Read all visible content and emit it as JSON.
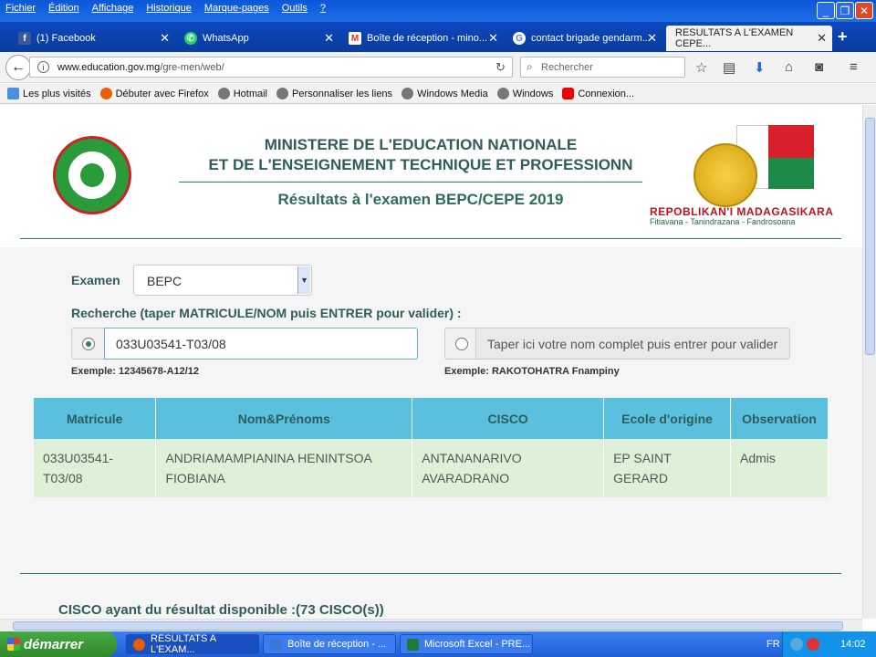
{
  "menubar": {
    "items": [
      "Fichier",
      "Édition",
      "Affichage",
      "Historique",
      "Marque-pages",
      "Outils",
      "?"
    ]
  },
  "tabs": [
    {
      "label": "(1) Facebook",
      "icon": "facebook-icon",
      "color": "#3b5998"
    },
    {
      "label": "WhatsApp",
      "icon": "whatsapp-icon",
      "color": "#25d366"
    },
    {
      "label": "Boîte de réception - mino...",
      "icon": "gmail-icon",
      "color": "#d93025"
    },
    {
      "label": "contact brigade gendarm...",
      "icon": "google-icon",
      "color": "#4285f4"
    },
    {
      "label": "RESULTATS A L'EXAMEN CEPE...",
      "icon": "",
      "color": ""
    }
  ],
  "navbar": {
    "url_host": "www.education.gov.mg",
    "url_path": "/gre-men/web/",
    "search_placeholder": "Rechercher"
  },
  "bookmarks": [
    {
      "label": "Les plus visités",
      "icon": "star-folder-icon"
    },
    {
      "label": "Débuter avec Firefox",
      "icon": "firefox-icon"
    },
    {
      "label": "Hotmail",
      "icon": "globe-icon"
    },
    {
      "label": "Personnaliser les liens",
      "icon": "globe-icon"
    },
    {
      "label": "Windows Media",
      "icon": "globe-icon"
    },
    {
      "label": "Windows",
      "icon": "globe-icon"
    },
    {
      "label": "Connexion...",
      "icon": "youtube-icon"
    }
  ],
  "header": {
    "title_line1": "MINISTERE DE L'EDUCATION NATIONALE",
    "title_line2": "ET DE L'ENSEIGNEMENT TECHNIQUE ET PROFESSIONN",
    "subtitle": "Résultats à l'examen BEPC/CEPE 2019",
    "republic_name": "REPOBLIKAN'I MADAGASIKARA",
    "republic_motto": "Fitiavana - Tanindrazana - Fandrosoana"
  },
  "form": {
    "exam_label": "Examen",
    "exam_selected": "BEPC",
    "search_label": "Recherche (taper MATRICULE/NOM puis ENTRER pour valider) :",
    "matricule_value": "033U03541-T03/08",
    "name_placeholder": "Taper ici votre nom complet puis entrer pour valider",
    "example_matricule": "Exemple: 12345678-A12/12",
    "example_name": "Exemple: RAKOTOHATRA Fnampiny"
  },
  "table": {
    "headers": [
      "Matricule",
      "Nom&Prénoms",
      "CISCO",
      "Ecole d'origine",
      "Observation"
    ],
    "rows": [
      [
        "033U03541-T03/08",
        "ANDRIAMAMPIANINA HENINTSOA FIOBIANA",
        "ANTANANARIVO AVARADRANO",
        "EP SAINT GERARD",
        "Admis"
      ]
    ]
  },
  "cisco_summary": "CISCO ayant du résultat disponible :(73 CISCO(s))",
  "taskbar": {
    "start_label": "démarrer",
    "tasks": [
      {
        "label": "RESULTATS A L'EXAM...",
        "icon": "firefox-icon"
      },
      {
        "label": "Boîte de réception - ...",
        "icon": "outlook-icon"
      },
      {
        "label": "Microsoft Excel - PRE...",
        "icon": "excel-icon"
      }
    ],
    "language": "FR",
    "clock": "14:02"
  },
  "colors": {
    "accent_teal": "#2e5d5a",
    "table_header": "#5bc0de",
    "table_row": "#dff0d8"
  }
}
